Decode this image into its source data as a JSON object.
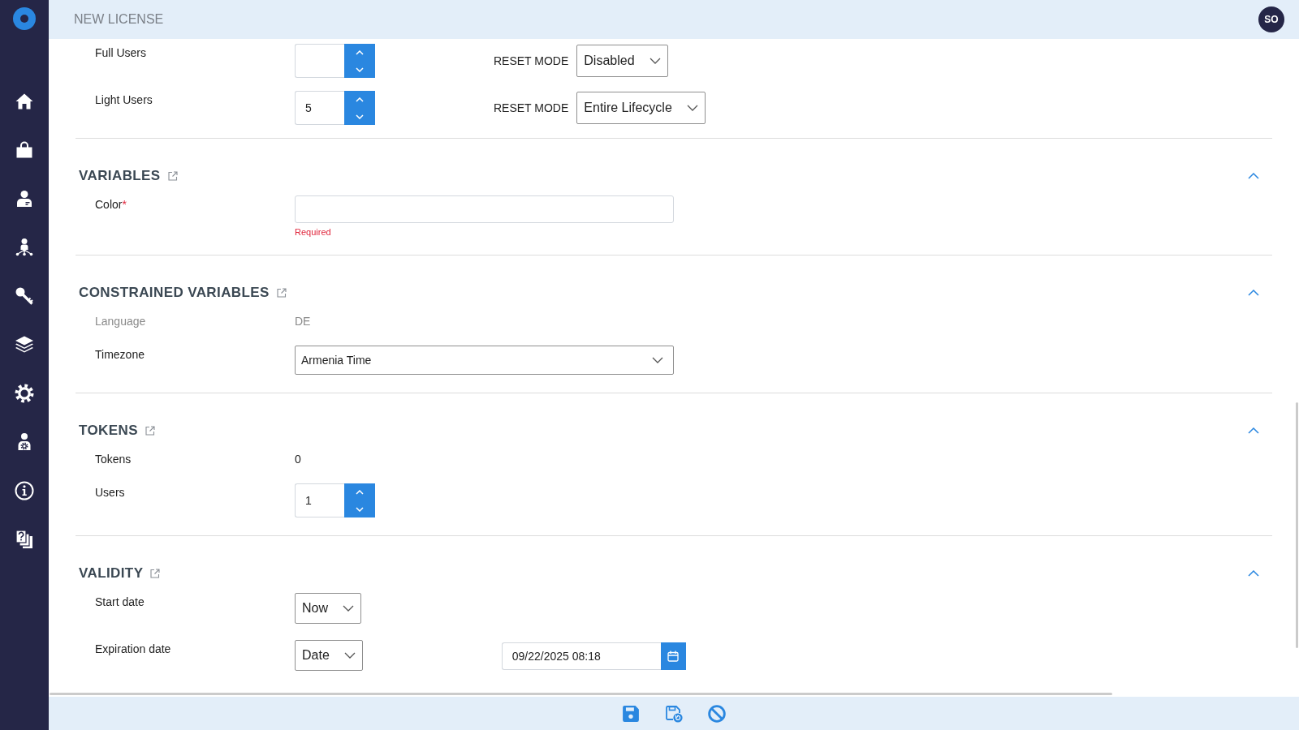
{
  "header": {
    "title": "NEW LICENSE",
    "avatar": "SO"
  },
  "user_limits": [
    {
      "label": "Full Users",
      "reset_label": "RESET MODE",
      "reset_value": "Disabled"
    },
    {
      "label": "Light Users",
      "value": "5",
      "reset_label": "RESET MODE",
      "reset_value": "Entire Lifecycle"
    }
  ],
  "sections": [
    {
      "title": "VARIABLES",
      "expanded": true,
      "fields": [
        {
          "kind": "text",
          "label": "Color",
          "required_mark": "*",
          "error": "Required",
          "disabled": false
        }
      ]
    },
    {
      "title": "CONSTRAINED VARIABLES",
      "expanded": true,
      "fields": [
        {
          "kind": "static",
          "label": "Language",
          "value": "DE",
          "disabled": true
        },
        {
          "kind": "combobox",
          "label": "Timezone",
          "value": "Armenia Time",
          "disabled": false
        }
      ]
    },
    {
      "title": "TOKENS",
      "expanded": true,
      "fields": [
        {
          "kind": "static",
          "label": "Tokens",
          "value": "0",
          "disabled": false
        },
        {
          "kind": "stepper",
          "label": "Users",
          "value": "1",
          "disabled": false
        }
      ]
    },
    {
      "title": "VALIDITY",
      "expanded": true,
      "fields": [
        {
          "kind": "select",
          "label": "Start date",
          "value": "Now",
          "disabled": false
        },
        {
          "kind": "select",
          "label": "Expiration date",
          "value": "Date",
          "date": "09/22/2025 08:18",
          "disabled": false
        }
      ]
    }
  ]
}
